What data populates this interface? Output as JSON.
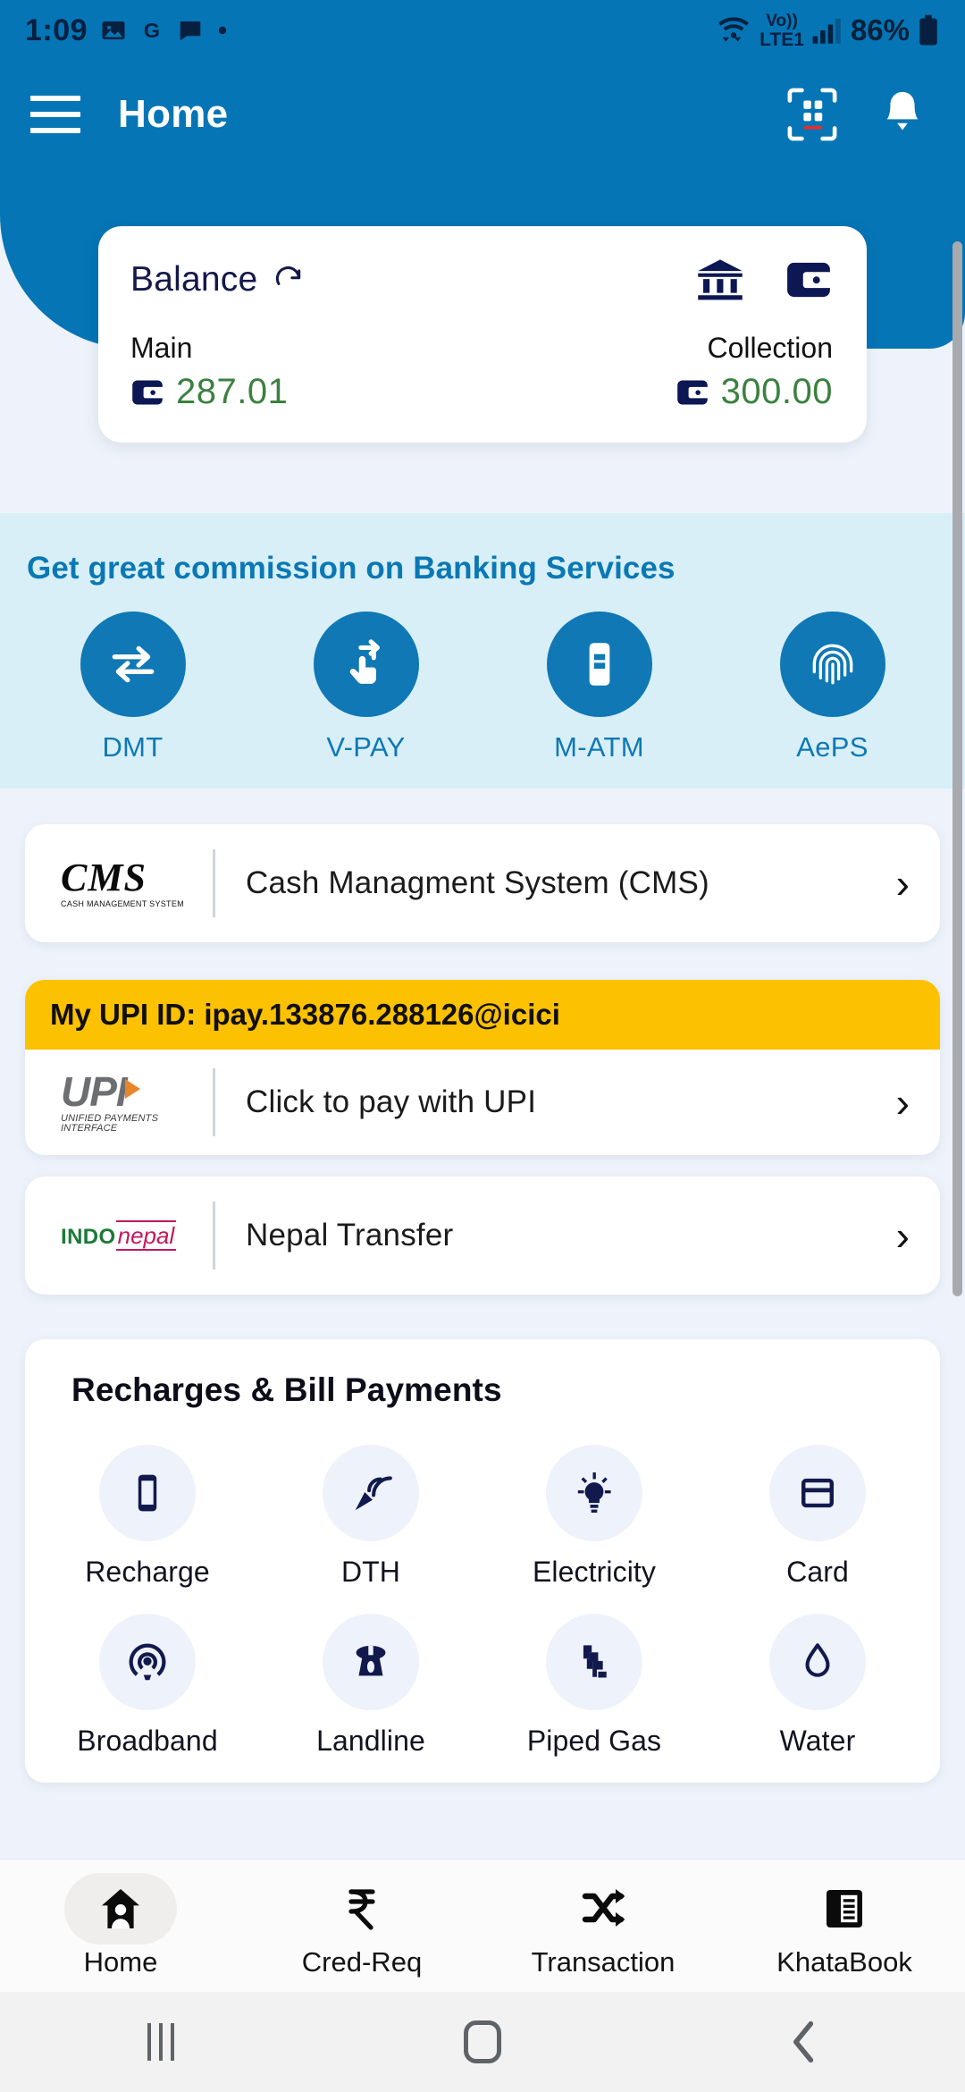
{
  "status_bar": {
    "time": "1:09",
    "left_icons": [
      "photos-icon",
      "google-icon",
      "message-icon",
      "dot-icon"
    ],
    "network_label": "LTE1",
    "volte_label": "Vo))",
    "battery_percent": "86%",
    "right_icons": [
      "wifi-icon",
      "signal-icon",
      "battery-icon"
    ]
  },
  "app_bar": {
    "menu_icon": "hamburger-menu-icon",
    "title": "Home",
    "scan_icon": "qr-scan-icon",
    "notification_icon": "bell-icon"
  },
  "balance_card": {
    "title": "Balance",
    "refresh_icon": "refresh-icon",
    "bank_icon": "bank-icon",
    "wallet_icon": "wallet-icon",
    "main": {
      "label": "Main",
      "icon": "wallet-icon",
      "amount": "287.01"
    },
    "collection": {
      "label": "Collection",
      "icon": "wallet-icon",
      "amount": "300.00"
    },
    "amount_color": "#3c8040"
  },
  "banking_services": {
    "heading": "Get great commission on Banking Services",
    "background": "#d8eff8",
    "accent": "#0f78b5",
    "items": [
      {
        "label": "DMT",
        "icon": "transfer-arrows-icon"
      },
      {
        "label": "V-PAY",
        "icon": "tap-pay-icon"
      },
      {
        "label": "M-ATM",
        "icon": "mobile-atm-icon"
      },
      {
        "label": "AePS",
        "icon": "fingerprint-icon"
      }
    ]
  },
  "cms_row": {
    "logo_main": "CMS",
    "logo_sub": "CASH MANAGEMENT SYSTEM",
    "label": "Cash Managment System (CMS)",
    "chevron": "chevron-right-icon"
  },
  "upi_section": {
    "banner_text": "My UPI ID: ipay.133876.288126@icici",
    "banner_color": "#fcc100",
    "logo_word": "UPI",
    "logo_sub": "UNIFIED PAYMENTS INTERFACE",
    "label": "Click to pay with UPI",
    "chevron": "chevron-right-icon"
  },
  "nepal_row": {
    "logo_indo": "INDO",
    "logo_nepal": "nepal",
    "label": "Nepal Transfer",
    "chevron": "chevron-right-icon"
  },
  "recharges": {
    "title": "Recharges & Bill Payments",
    "items": [
      {
        "label": "Recharge",
        "icon": "mobile-phone-icon"
      },
      {
        "label": "DTH",
        "icon": "satellite-dish-icon"
      },
      {
        "label": "Electricity",
        "icon": "light-bulb-icon"
      },
      {
        "label": "Card",
        "icon": "credit-card-icon"
      },
      {
        "label": "Broadband",
        "icon": "broadband-signal-icon"
      },
      {
        "label": "Landline",
        "icon": "landline-phone-icon"
      },
      {
        "label": "Piped Gas",
        "icon": "gas-pipe-icon"
      },
      {
        "label": "Water",
        "icon": "water-drop-icon"
      }
    ]
  },
  "bottom_nav": {
    "items": [
      {
        "label": "Home",
        "icon": "home-user-icon",
        "active": true
      },
      {
        "label": "Cred-Req",
        "icon": "rupee-icon",
        "active": false
      },
      {
        "label": "Transaction",
        "icon": "shuffle-arrows-icon",
        "active": false
      },
      {
        "label": "KhataBook",
        "icon": "ledger-book-icon",
        "active": false
      }
    ]
  },
  "system_nav": {
    "recents": "recents-icon",
    "home": "home-circle-icon",
    "back": "back-chevron-icon"
  }
}
